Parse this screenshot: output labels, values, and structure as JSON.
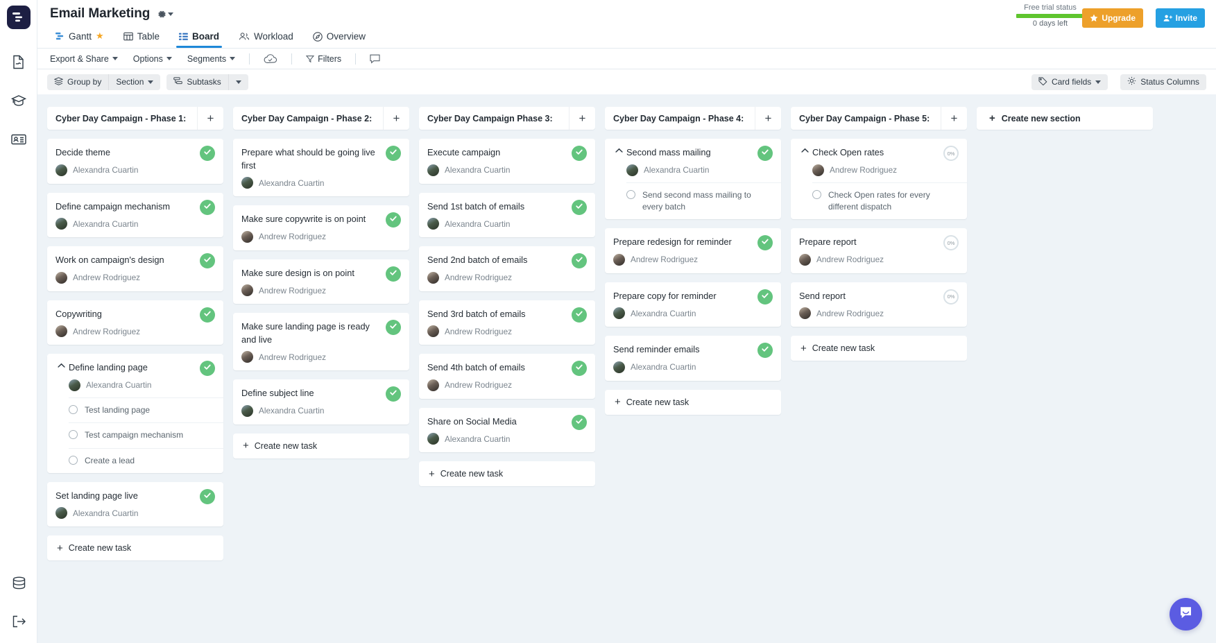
{
  "app": {
    "logo_icon": "wrike-logo-icon"
  },
  "rail": {
    "items": [
      {
        "icon": "document-icon",
        "name": "documents"
      },
      {
        "icon": "graduation-cap-icon",
        "name": "learning"
      },
      {
        "icon": "id-card-icon",
        "name": "contacts"
      }
    ],
    "bottom_items": [
      {
        "icon": "database-icon",
        "name": "database"
      },
      {
        "icon": "logout-icon",
        "name": "logout"
      }
    ]
  },
  "header": {
    "project_title": "Email Marketing",
    "gear_icon": "gear-icon",
    "trial": {
      "label": "Free trial status",
      "days_left": "0 days left",
      "bar_color": "#5fc52e"
    },
    "upgrade_label": "Upgrade",
    "upgrade_icon": "star-icon",
    "upgrade_color": "#eda02a",
    "invite_label": "Invite",
    "invite_icon": "person-add-icon",
    "invite_color": "#25a0e2"
  },
  "tabs": [
    {
      "label": "Gantt",
      "icon": "gantt-icon",
      "active": false,
      "starred": true
    },
    {
      "label": "Table",
      "icon": "table-icon",
      "active": false,
      "starred": false
    },
    {
      "label": "Board",
      "icon": "board-icon",
      "active": true,
      "starred": false
    },
    {
      "label": "Workload",
      "icon": "people-icon",
      "active": false,
      "starred": false
    },
    {
      "label": "Overview",
      "icon": "overview-icon",
      "active": false,
      "starred": false
    }
  ],
  "toolbar": {
    "export_share": "Export & Share",
    "options": "Options",
    "segments": "Segments",
    "cloud_icon": "cloud-check-icon",
    "filters": "Filters",
    "filters_icon": "filter-icon",
    "comment_icon": "comment-icon"
  },
  "toolbar2": {
    "group_by": "Group by",
    "group_by_icon": "layers-icon",
    "group_by_value": "Section",
    "subtasks": "Subtasks",
    "subtasks_icon": "subtask-icon",
    "card_fields": "Card fields",
    "card_fields_icon": "tag-icon",
    "status_columns": "Status Columns",
    "status_columns_icon": "gear-icon"
  },
  "board": {
    "create_section_label": "Create new section",
    "create_task_label": "Create new task",
    "add_icon": "plus-icon",
    "columns": [
      {
        "title": "Cyber Day Campaign - Phase 1:",
        "cards": [
          {
            "title": "Decide theme",
            "assignee": "Alexandra Cuartin",
            "avatar": "a",
            "status": "check"
          },
          {
            "title": "Define campaign mechanism",
            "assignee": "Alexandra Cuartin",
            "avatar": "a",
            "status": "check"
          },
          {
            "title": "Work on campaign's design",
            "assignee": "Andrew Rodriguez",
            "avatar": "b",
            "status": "check"
          },
          {
            "title": "Copywriting",
            "assignee": "Andrew Rodriguez",
            "avatar": "b",
            "status": "check"
          },
          {
            "title": "Define landing page",
            "assignee": "Alexandra Cuartin",
            "avatar": "a",
            "status": "check",
            "expanded": true,
            "subtasks": [
              "Test landing page",
              "Test campaign mechanism",
              "Create a lead"
            ]
          },
          {
            "title": "Set landing page live",
            "assignee": "Alexandra Cuartin",
            "avatar": "a",
            "status": "check"
          }
        ],
        "show_create_task": true
      },
      {
        "title": "Cyber Day Campaign - Phase 2:",
        "cards": [
          {
            "title": "Prepare what should be going live first",
            "assignee": "Alexandra Cuartin",
            "avatar": "a",
            "status": "check"
          },
          {
            "title": "Make sure copywrite is on point",
            "assignee": "Andrew Rodriguez",
            "avatar": "b",
            "status": "check"
          },
          {
            "title": "Make sure design is on point",
            "assignee": "Andrew Rodriguez",
            "avatar": "b",
            "status": "check"
          },
          {
            "title": "Make sure landing page is ready and live",
            "assignee": "Andrew Rodriguez",
            "avatar": "b",
            "status": "check"
          },
          {
            "title": "Define subject line",
            "assignee": "Alexandra Cuartin",
            "avatar": "a",
            "status": "check"
          }
        ],
        "show_create_task": true
      },
      {
        "title": "Cyber Day Campaign Phase 3:",
        "cards": [
          {
            "title": "Execute campaign",
            "assignee": "Alexandra Cuartin",
            "avatar": "a",
            "status": "check"
          },
          {
            "title": "Send 1st batch of emails",
            "assignee": "Alexandra Cuartin",
            "avatar": "a",
            "status": "check"
          },
          {
            "title": "Send 2nd batch of emails",
            "assignee": "Andrew Rodriguez",
            "avatar": "b",
            "status": "check"
          },
          {
            "title": "Send 3rd batch of emails",
            "assignee": "Andrew Rodriguez",
            "avatar": "b",
            "status": "check"
          },
          {
            "title": "Send 4th batch of emails",
            "assignee": "Andrew Rodriguez",
            "avatar": "b",
            "status": "check"
          },
          {
            "title": "Share on Social Media",
            "assignee": "Alexandra Cuartin",
            "avatar": "a",
            "status": "check"
          }
        ],
        "show_create_task": true
      },
      {
        "title": "Cyber Day Campaign - Phase 4:",
        "cards": [
          {
            "title": "Second mass mailing",
            "assignee": "Alexandra Cuartin",
            "avatar": "a",
            "status": "check",
            "expanded": true,
            "subtasks": [
              "Send second mass mailing to every batch"
            ]
          },
          {
            "title": "Prepare redesign for reminder",
            "assignee": "Andrew Rodriguez",
            "avatar": "b",
            "status": "check"
          },
          {
            "title": "Prepare copy for reminder",
            "assignee": "Alexandra Cuartin",
            "avatar": "a",
            "status": "check"
          },
          {
            "title": "Send reminder emails",
            "assignee": "Alexandra Cuartin",
            "avatar": "a",
            "status": "check"
          }
        ],
        "show_create_task": true
      },
      {
        "title": "Cyber Day Campaign - Phase 5:",
        "cards": [
          {
            "title": "Check Open rates",
            "assignee": "Andrew Rodriguez",
            "avatar": "b",
            "status": "percent",
            "percent": "0%",
            "expanded": true,
            "subtasks": [
              "Check Open rates for every different dispatch"
            ]
          },
          {
            "title": "Prepare report",
            "assignee": "Andrew Rodriguez",
            "avatar": "b",
            "status": "percent",
            "percent": "0%"
          },
          {
            "title": "Send report",
            "assignee": "Andrew Rodriguez",
            "avatar": "b",
            "status": "percent",
            "percent": "0%"
          }
        ],
        "show_create_task": true
      }
    ]
  },
  "chat": {
    "icon": "chat-icon",
    "color": "#5b5ce2"
  }
}
